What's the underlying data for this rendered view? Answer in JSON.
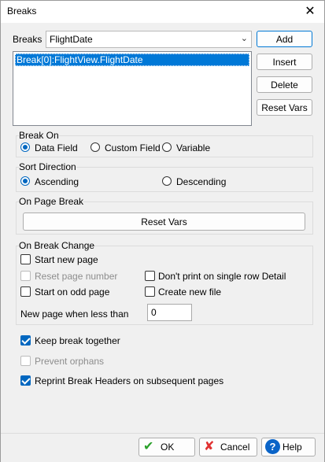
{
  "window": {
    "title": "Breaks",
    "close_glyph": "✕"
  },
  "breaks": {
    "label": "Breaks",
    "combo_value": "FlightDate",
    "combo_arrow": "⌄",
    "list_items": [
      "Break[0]:FlightView.FlightDate"
    ],
    "buttons": {
      "add": "Add",
      "insert": "Insert",
      "delete": "Delete",
      "reset_vars": "Reset Vars"
    }
  },
  "break_on": {
    "title": "Break On",
    "options": [
      "Data Field",
      "Custom Field",
      "Variable"
    ],
    "selected": "Data Field"
  },
  "sort_direction": {
    "title": "Sort Direction",
    "options": [
      "Ascending",
      "Descending"
    ],
    "selected": "Ascending"
  },
  "on_page_break": {
    "title": "On Page Break",
    "reset_vars": "Reset Vars"
  },
  "on_break_change": {
    "title": "On Break Change",
    "start_new_page": "Start new page",
    "reset_page_number": "Reset page number",
    "dont_print": "Don't print on single row Detail",
    "start_on_odd_page": "Start on odd page",
    "create_new_file": "Create new file",
    "new_page_label": "New page when less than",
    "new_page_value": "0"
  },
  "options": {
    "keep_together": "Keep break together",
    "prevent_orphans": "Prevent orphans",
    "reprint_headers": "Reprint Break Headers on subsequent pages"
  },
  "footer": {
    "ok": "OK",
    "cancel": "Cancel",
    "help": "Help",
    "help_glyph": "?"
  },
  "colors": {
    "accent": "#0067c0",
    "selection": "#0078d7",
    "ok_check": "#2aa02a",
    "cancel_x": "#e03030"
  }
}
